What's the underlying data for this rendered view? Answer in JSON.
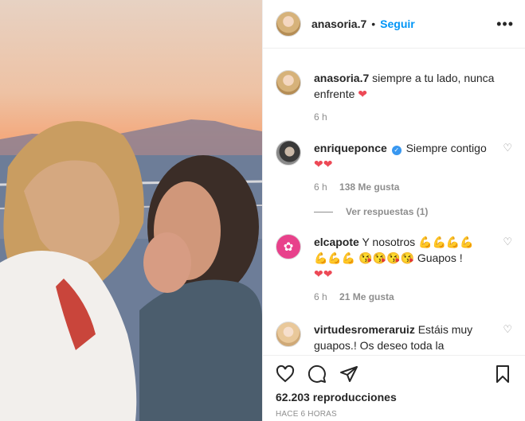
{
  "post": {
    "author": "anasoria.7",
    "follow_label": "Seguir",
    "separator": "•",
    "more_label": "•••"
  },
  "caption": {
    "username": "anasoria.7",
    "text": "siempre a tu lado, nunca enfrente",
    "emoji": "❤",
    "time": "6 h"
  },
  "comments": [
    {
      "username": "enriqueponce",
      "verified": true,
      "text": "Siempre contigo",
      "emoji": "❤❤",
      "time": "6 h",
      "likes": "138 Me gusta"
    },
    {
      "username": "elcapote",
      "text_before": "Y nosotros",
      "emoji_flex_1": "💪💪💪💪",
      "emoji_flex_2": "💪💪💪",
      "emoji_faces": "😘😘😘😘",
      "text_after": "Guapos !",
      "emoji": "❤❤",
      "time": "6 h",
      "likes": "21 Me gusta"
    },
    {
      "username": "virtudesromeraruiz",
      "text": "Estáis muy guapos.! Os deseo toda la"
    }
  ],
  "view_replies": "Ver respuestas (1)",
  "stats": {
    "views": "62.203 reproducciones",
    "posted": "HACE 6 HORAS"
  },
  "icons": {
    "like": "heart-icon",
    "comment": "comment-icon",
    "share": "share-icon",
    "save": "bookmark-icon",
    "more": "more-icon"
  },
  "colors": {
    "link_blue": "#0095f6",
    "like_red": "#ed4956",
    "muted": "#8e8e8e"
  }
}
